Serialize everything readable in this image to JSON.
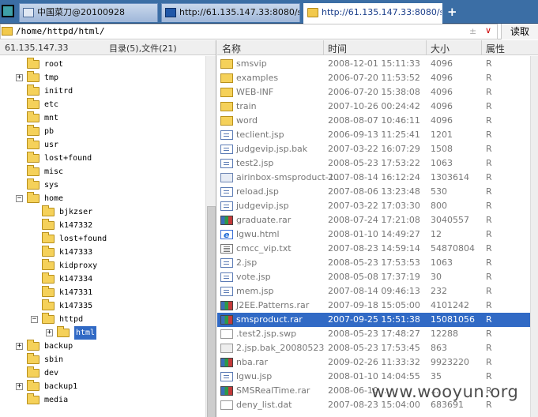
{
  "tabs": [
    {
      "label": "中国菜刀@20100928",
      "icon": "page-icon",
      "active": false
    },
    {
      "label": "http://61.135.147.33:8080/s...",
      "icon": "globe-icon",
      "active": false
    },
    {
      "label": "http://61.135.147.33:8080/s...",
      "icon": "folder-icon",
      "active": true
    }
  ],
  "new_tab_label": "+",
  "address": {
    "path": "/home/httpd/html/",
    "sync_glyph": "±",
    "dropdown_glyph": "∨",
    "read_button": "读取"
  },
  "left_panel": {
    "host": "61.135.147.33",
    "summary": "目录(5),文件(21)",
    "tree": [
      {
        "label": "root",
        "depth": 1,
        "toggle": ""
      },
      {
        "label": "tmp",
        "depth": 1,
        "toggle": "+"
      },
      {
        "label": "initrd",
        "depth": 1,
        "toggle": ""
      },
      {
        "label": "etc",
        "depth": 1,
        "toggle": ""
      },
      {
        "label": "mnt",
        "depth": 1,
        "toggle": ""
      },
      {
        "label": "pb",
        "depth": 1,
        "toggle": ""
      },
      {
        "label": "usr",
        "depth": 1,
        "toggle": ""
      },
      {
        "label": "lost+found",
        "depth": 1,
        "toggle": ""
      },
      {
        "label": "misc",
        "depth": 1,
        "toggle": ""
      },
      {
        "label": "sys",
        "depth": 1,
        "toggle": ""
      },
      {
        "label": "home",
        "depth": 1,
        "toggle": "−"
      },
      {
        "label": "bjkzser",
        "depth": 2,
        "toggle": ""
      },
      {
        "label": "k147332",
        "depth": 2,
        "toggle": ""
      },
      {
        "label": "lost+found",
        "depth": 2,
        "toggle": ""
      },
      {
        "label": "k147333",
        "depth": 2,
        "toggle": ""
      },
      {
        "label": "kidproxy",
        "depth": 2,
        "toggle": ""
      },
      {
        "label": "k147334",
        "depth": 2,
        "toggle": ""
      },
      {
        "label": "k147331",
        "depth": 2,
        "toggle": ""
      },
      {
        "label": "k147335",
        "depth": 2,
        "toggle": ""
      },
      {
        "label": "httpd",
        "depth": 2,
        "toggle": "−"
      },
      {
        "label": "html",
        "depth": 3,
        "toggle": "+",
        "selected": true
      },
      {
        "label": "backup",
        "depth": 1,
        "toggle": "+"
      },
      {
        "label": "sbin",
        "depth": 1,
        "toggle": ""
      },
      {
        "label": "dev",
        "depth": 1,
        "toggle": ""
      },
      {
        "label": "backup1",
        "depth": 1,
        "toggle": "+"
      },
      {
        "label": "media",
        "depth": 1,
        "toggle": ""
      }
    ]
  },
  "columns": {
    "name": "名称",
    "time": "时间",
    "size": "大小",
    "attr": "属性"
  },
  "files": [
    {
      "name": "smsvip",
      "time": "2008-12-01 15:11:33",
      "size": "4096",
      "attr": "R",
      "type": "folder"
    },
    {
      "name": "examples",
      "time": "2006-07-20 11:53:52",
      "size": "4096",
      "attr": "R",
      "type": "folder"
    },
    {
      "name": "WEB-INF",
      "time": "2006-07-20 15:38:08",
      "size": "4096",
      "attr": "R",
      "type": "folder"
    },
    {
      "name": "train",
      "time": "2007-10-26 00:24:42",
      "size": "4096",
      "attr": "R",
      "type": "folder"
    },
    {
      "name": "word",
      "time": "2008-08-07 10:46:11",
      "size": "4096",
      "attr": "R",
      "type": "folder"
    },
    {
      "name": "teclient.jsp",
      "time": "2006-09-13 11:25:41",
      "size": "1201",
      "attr": "R",
      "type": "jsp"
    },
    {
      "name": "judgevip.jsp.bak",
      "time": "2007-03-22 16:07:29",
      "size": "1508",
      "attr": "R",
      "type": "jsp"
    },
    {
      "name": "test2.jsp",
      "time": "2008-05-23 17:53:22",
      "size": "1063",
      "attr": "R",
      "type": "jsp"
    },
    {
      "name": "airinbox-smsproduct-1...",
      "time": "2007-08-14 16:12:24",
      "size": "1303614",
      "attr": "R",
      "type": "gif"
    },
    {
      "name": "reload.jsp",
      "time": "2007-08-06 13:23:48",
      "size": "530",
      "attr": "R",
      "type": "jsp"
    },
    {
      "name": "judgevip.jsp",
      "time": "2007-03-22 17:03:30",
      "size": "800",
      "attr": "R",
      "type": "jsp"
    },
    {
      "name": "graduate.rar",
      "time": "2008-07-24 17:21:08",
      "size": "3040557",
      "attr": "R",
      "type": "rar"
    },
    {
      "name": "lgwu.html",
      "time": "2008-01-10 14:49:27",
      "size": "12",
      "attr": "R",
      "type": "html"
    },
    {
      "name": "cmcc_vip.txt",
      "time": "2007-08-23 14:59:14",
      "size": "54870804",
      "attr": "R",
      "type": "txt"
    },
    {
      "name": "2.jsp",
      "time": "2008-05-23 17:53:53",
      "size": "1063",
      "attr": "R",
      "type": "jsp"
    },
    {
      "name": "vote.jsp",
      "time": "2008-05-08 17:37:19",
      "size": "30",
      "attr": "R",
      "type": "jsp"
    },
    {
      "name": "mem.jsp",
      "time": "2007-08-14 09:46:13",
      "size": "232",
      "attr": "R",
      "type": "jsp"
    },
    {
      "name": "J2EE.Patterns.rar",
      "time": "2007-09-18 15:05:00",
      "size": "4101242",
      "attr": "R",
      "type": "rar"
    },
    {
      "name": "smsproduct.rar",
      "time": "2007-09-25 15:51:38",
      "size": "15081056",
      "attr": "R",
      "type": "rar",
      "selected": true
    },
    {
      "name": ".test2.jsp.swp",
      "time": "2008-05-23 17:48:27",
      "size": "12288",
      "attr": "R",
      "type": "swp"
    },
    {
      "name": "2.jsp.bak_20080523",
      "time": "2008-05-23 17:53:45",
      "size": "863",
      "attr": "R",
      "type": "bak"
    },
    {
      "name": "nba.rar",
      "time": "2009-02-26 11:33:32",
      "size": "9923220",
      "attr": "R",
      "type": "rar"
    },
    {
      "name": "lgwu.jsp",
      "time": "2008-01-10 14:04:55",
      "size": "35",
      "attr": "R",
      "type": "jsp"
    },
    {
      "name": "SMSRealTime.rar",
      "time": "2008-06-10 ...",
      "size": "...",
      "attr": "R",
      "type": "rar"
    },
    {
      "name": "deny_list.dat",
      "time": "2007-08-23 15:04:00",
      "size": "683691",
      "attr": "R",
      "type": "dat"
    }
  ],
  "watermark": "www.wooyun.org",
  "colors": {
    "selection": "#316ac5",
    "tabbar": "#3b6ea5",
    "folder": "#f5d15a",
    "read_button_text": "#000000"
  }
}
